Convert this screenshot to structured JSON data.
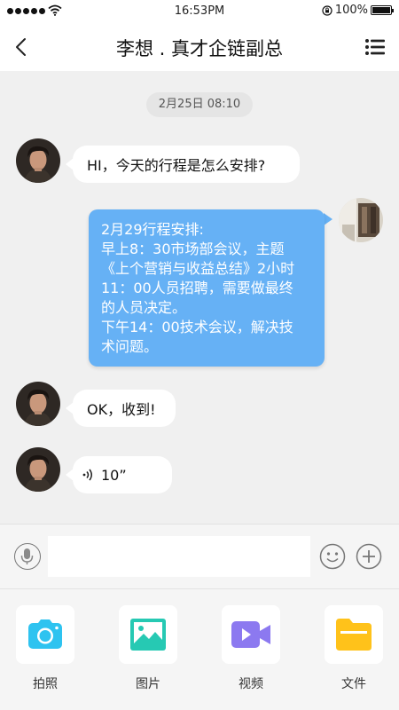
{
  "status_bar": {
    "time": "16:53PM",
    "battery": "100%"
  },
  "header": {
    "title": "李想 . 真才企链副总"
  },
  "chat": {
    "date": "2月25日 08:10",
    "messages": [
      {
        "side": "in",
        "text": "HI，今天的行程是怎么安排?"
      },
      {
        "side": "out",
        "lines": [
          "2月29行程安排:",
          "早上8：30市场部会议，主题",
          "《上个营销与收益总结》2小时",
          "11：00人员招聘，需要做最终",
          "的人员决定。",
          "下午14：00技术会议，解决技",
          "术问题。"
        ]
      },
      {
        "side": "in",
        "text": "OK，收到!"
      },
      {
        "side": "in",
        "type": "voice",
        "duration": "10”"
      }
    ]
  },
  "input": {
    "value": "",
    "placeholder": ""
  },
  "tools": [
    {
      "label": "拍照",
      "icon": "camera-icon",
      "color": "#2ec3f0"
    },
    {
      "label": "图片",
      "icon": "image-icon",
      "color": "#26c9b3"
    },
    {
      "label": "视频",
      "icon": "video-icon",
      "color": "#8c79f0"
    },
    {
      "label": "文件",
      "icon": "folder-icon",
      "color": "#ffc21a"
    }
  ],
  "colors": {
    "outgoing_bubble": "#66b1f5",
    "incoming_bubble": "#ffffff",
    "chat_background": "#f0f0f0"
  }
}
